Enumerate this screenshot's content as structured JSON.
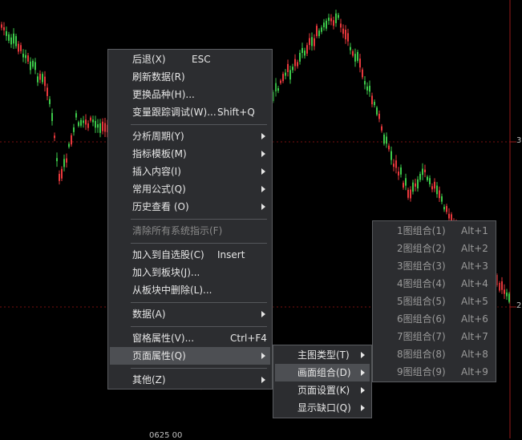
{
  "colors": {
    "up": "#e8383c",
    "down": "#3cc84a",
    "grid": "#7a1010",
    "menu_bg": "#2c2d30",
    "highlight": "#4d4f53"
  },
  "axis": {
    "right_tick_3": "3",
    "right_tick_2": "2",
    "bottom_partial": "0625 00"
  },
  "context_menu": {
    "items": [
      {
        "label": "后退(X)",
        "shortcut": "ESC"
      },
      {
        "label": "刷新数据(R)"
      },
      {
        "label": "更换品种(H)..."
      },
      {
        "label": "变量跟踪调试(W)...",
        "shortcut": "Shift+Q"
      },
      {
        "label": "分析周期(Y)",
        "submenu": true
      },
      {
        "label": "指标模板(M)",
        "submenu": true
      },
      {
        "label": "插入内容(I)",
        "submenu": true
      },
      {
        "label": "常用公式(Q)",
        "submenu": true
      },
      {
        "label": "历史查看 (O)",
        "submenu": true
      },
      {
        "label": "清除所有系统指示(F)",
        "disabled": true
      },
      {
        "label": "加入到自选股(C)",
        "shortcut": "Insert"
      },
      {
        "label": "加入到板块(J)..."
      },
      {
        "label": "从板块中删除(L)..."
      },
      {
        "label": "数据(A)",
        "submenu": true
      },
      {
        "label": "窗格属性(V)...",
        "shortcut": "Ctrl+F4"
      },
      {
        "label": "页面属性(Q)",
        "submenu": true,
        "highlighted": true
      },
      {
        "label": "其他(Z)",
        "submenu": true
      }
    ]
  },
  "page_props_menu": {
    "items": [
      {
        "label": "主图类型(T)",
        "submenu": true
      },
      {
        "label": "画面组合(D)",
        "submenu": true,
        "highlighted": true
      },
      {
        "label": "页面设置(K)",
        "submenu": true
      },
      {
        "label": "显示缺口(Q)",
        "submenu": true
      }
    ]
  },
  "layout_menu": {
    "items": [
      {
        "label": "1图组合(1)",
        "shortcut": "Alt+1"
      },
      {
        "label": "2图组合(2)",
        "shortcut": "Alt+2"
      },
      {
        "label": "3图组合(3)",
        "shortcut": "Alt+3"
      },
      {
        "label": "4图组合(4)",
        "shortcut": "Alt+4"
      },
      {
        "label": "5图组合(5)",
        "shortcut": "Alt+5"
      },
      {
        "label": "6图组合(6)",
        "shortcut": "Alt+6"
      },
      {
        "label": "7图组合(7)",
        "shortcut": "Alt+7"
      },
      {
        "label": "8图组合(8)",
        "shortcut": "Alt+8"
      },
      {
        "label": "9图组合(9)",
        "shortcut": "Alt+9"
      }
    ]
  }
}
